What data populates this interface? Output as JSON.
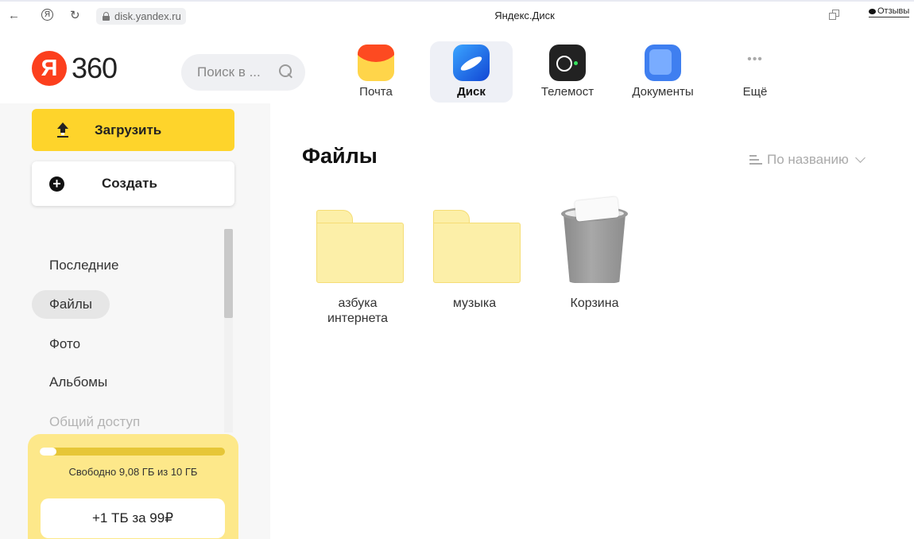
{
  "browser": {
    "back": "←",
    "yandex_icon": "Я",
    "reload": "↻",
    "url": "disk.yandex.ru",
    "tab_title": "Яндекс.Диск",
    "feedback": "Отзывы"
  },
  "header": {
    "logo_letter": "Я",
    "logo_text": "360",
    "search_placeholder": "Поиск в ...",
    "apps": [
      {
        "label": "Почта",
        "icon": "mail-icon"
      },
      {
        "label": "Диск",
        "icon": "disk-icon",
        "active": true
      },
      {
        "label": "Телемост",
        "icon": "telemost-icon"
      },
      {
        "label": "Документы",
        "icon": "documents-icon"
      },
      {
        "label": "Ещё",
        "icon": "more-icon"
      }
    ]
  },
  "sidebar": {
    "upload_label": "Загрузить",
    "create_label": "Создать",
    "nav": [
      {
        "label": "Последние"
      },
      {
        "label": "Файлы",
        "active": true
      },
      {
        "label": "Фото"
      },
      {
        "label": "Альбомы"
      },
      {
        "label": "Общий доступ"
      }
    ],
    "storage": {
      "used_fraction": 0.092,
      "text": "Свободно 9,08 ГБ из 10 ГБ",
      "promo": "+1 ТБ за 99₽"
    }
  },
  "main": {
    "title": "Файлы",
    "sort_label": "По названию",
    "items": [
      {
        "name": "азбука интернета",
        "type": "folder"
      },
      {
        "name": "музыка",
        "type": "folder"
      },
      {
        "name": "Корзина",
        "type": "trash"
      }
    ]
  },
  "colors": {
    "accent_yellow": "#fed42b",
    "logo_red": "#fc3f1d",
    "folder_fill": "#fcefa8",
    "storage_bg": "#fde88a"
  }
}
